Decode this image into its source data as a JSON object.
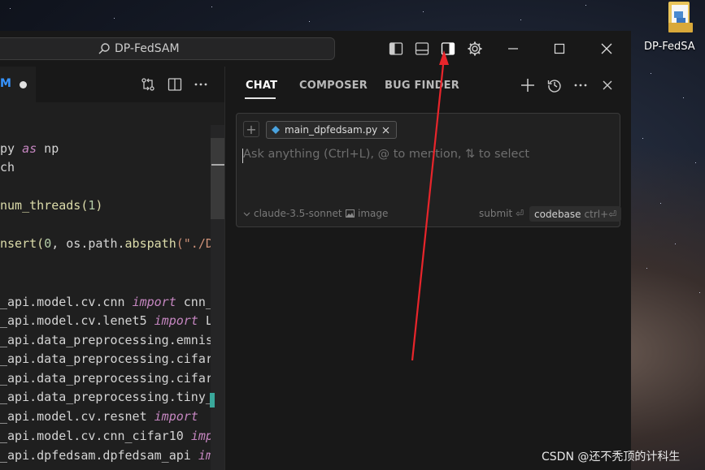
{
  "desktop": {
    "folder_label": "DP-FedSA"
  },
  "titlebar": {
    "search_text": "DP-FedSAM"
  },
  "editor": {
    "tab_label": "M",
    "code_lines": [
      {
        "before": "py ",
        "kw": "as",
        "after": " np"
      },
      {
        "before": "ch",
        "kw": "",
        "after": ""
      },
      {
        "before": "",
        "kw": "",
        "after": ""
      },
      {
        "before": "num_threads(",
        "kw": "",
        "after": "",
        "num": "1",
        "tail": ")"
      },
      {
        "before": "",
        "kw": "",
        "after": ""
      },
      {
        "before": "nsert(",
        "num": "0",
        "tail": ", os.path.",
        "fn": "abspath",
        "str": "(\"./D"
      },
      {
        "before": "",
        "kw": "",
        "after": ""
      },
      {
        "before": "",
        "kw": "",
        "after": ""
      },
      {
        "before": "_api.model.cv.cnn ",
        "kw": "import",
        "after": " cnn_"
      },
      {
        "before": "_api.model.cv.lenet5 ",
        "kw": "import",
        "after": " L"
      },
      {
        "before": "_api.data_preprocessing.emnis",
        "kw": "",
        "after": ""
      },
      {
        "before": "_api.data_preprocessing.cifar",
        "kw": "",
        "after": ""
      },
      {
        "before": "_api.data_preprocessing.cifar",
        "kw": "",
        "after": ""
      },
      {
        "before": "_api.data_preprocessing.tiny_",
        "kw": "",
        "after": ""
      },
      {
        "before": "_api.model.cv.resnet ",
        "kw": "import",
        "after": ""
      },
      {
        "before": "_api.model.cv.cnn_cifar10 ",
        "kw": "imp",
        "after": ""
      },
      {
        "before": "_api.dpfedsam.dpfedsam_api ",
        "kw": "im",
        "after": ""
      }
    ]
  },
  "chat": {
    "tabs": [
      "CHAT",
      "COMPOSER",
      "BUG FINDER"
    ],
    "file_pill": "main_dpfedsam.py",
    "placeholder": "Ask anything (Ctrl+L), @ to mention, ⇅ to select",
    "model": "claude-3.5-sonnet",
    "image_label": "image",
    "submit_label": "submit ⏎",
    "codebase_label": "codebase",
    "codebase_shortcut": "ctrl+⏎"
  },
  "watermark": "CSDN @还不秃顶的计科生",
  "colors": {
    "accent": "#3794ff",
    "annotation_arrow": "#e8252b",
    "keyword": "#c586c0"
  }
}
